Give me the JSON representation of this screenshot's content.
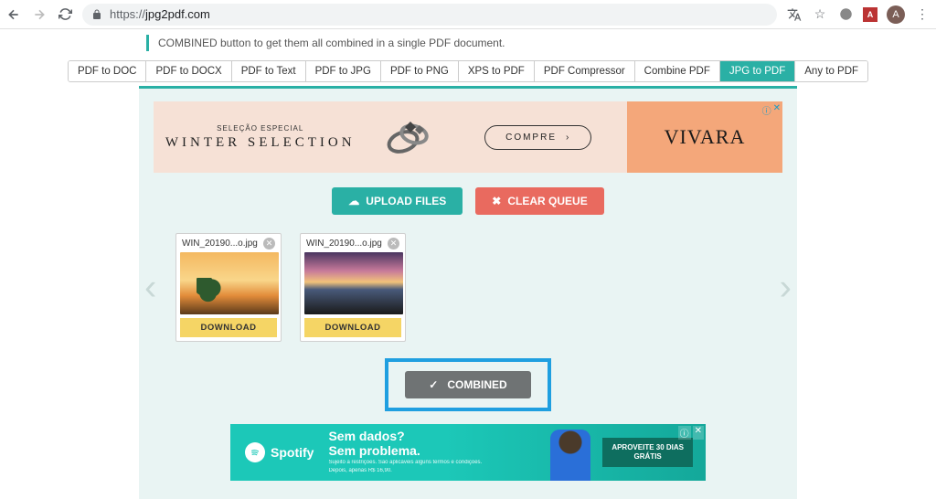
{
  "browser": {
    "url_protocol": "https://",
    "url_host": "jpg2pdf.com",
    "avatar_letter": "A"
  },
  "truncated_line": "COMBINED button to get them all combined in a single PDF document.",
  "tabs": [
    {
      "label": "PDF to DOC"
    },
    {
      "label": "PDF to DOCX"
    },
    {
      "label": "PDF to Text"
    },
    {
      "label": "PDF to JPG"
    },
    {
      "label": "PDF to PNG"
    },
    {
      "label": "XPS to PDF"
    },
    {
      "label": "PDF Compressor"
    },
    {
      "label": "Combine PDF"
    },
    {
      "label": "JPG to PDF"
    },
    {
      "label": "Any to PDF"
    }
  ],
  "active_tab_index": 8,
  "ad1": {
    "subtitle": "SELEÇÃO ESPECIAL",
    "title": "WINTER SELECTION",
    "cta": "COMPRE",
    "brand": "VIVARA"
  },
  "actions": {
    "upload": "UPLOAD FILES",
    "clear": "CLEAR QUEUE"
  },
  "files": [
    {
      "name": "WIN_20190...o.jpg",
      "download": "DOWNLOAD"
    },
    {
      "name": "WIN_20190...o.jpg",
      "download": "DOWNLOAD"
    }
  ],
  "combined_label": "COMBINED",
  "ad2": {
    "brand": "Spotify",
    "line1": "Sem dados?",
    "line2": "Sem problema.",
    "fineprint1": "Sujeito a restrições. São aplicáveis alguns termos e condições.",
    "fineprint2": "Depois, apenas R$ 16,90.",
    "cta1": "APROVEITE 30 DIAS",
    "cta2": "GRÁTIS"
  }
}
